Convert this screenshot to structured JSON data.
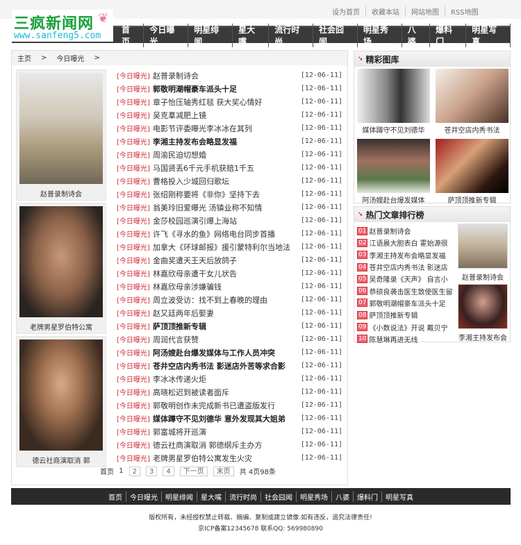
{
  "top_links": [
    "设为首页",
    "收藏本站",
    "网站地图",
    "RSS地图"
  ],
  "logo": {
    "name": "三疯新闻网",
    "url": "www.sanfeng5.com"
  },
  "nav": [
    "首页",
    "今日曝光",
    "明星绯闻",
    "星大嘴",
    "流行时尚",
    "社会囧闻",
    "明星秀场",
    "八婆",
    "爆料门",
    "明星写真"
  ],
  "breadcrumb": [
    "主页",
    ">",
    "今日曝光",
    ">"
  ],
  "left_pics": [
    {
      "caption": "赵普录制诗会"
    },
    {
      "caption": "老牌男星罗伯特公寓"
    },
    {
      "caption": "德云社商演取消 郭"
    }
  ],
  "list": [
    {
      "tag": "[今日曝光]",
      "title": "赵普录制诗会",
      "date": "[12-06-11]",
      "bold": false
    },
    {
      "tag": "[今日曝光]",
      "title": "郭敬明潮帽豪车派头十足",
      "date": "[12-06-11]",
      "bold": true
    },
    {
      "tag": "[今日曝光]",
      "title": "章子怡压轴秀红毯 获大奖心情好",
      "date": "[12-06-11]",
      "bold": false
    },
    {
      "tag": "[今日曝光]",
      "title": "吴克羣减肥上镜",
      "date": "[12-06-11]",
      "bold": false
    },
    {
      "tag": "[今日曝光]",
      "title": "电影节评委曝光李冰冰在其列",
      "date": "[12-06-11]",
      "bold": false
    },
    {
      "tag": "[今日曝光]",
      "title": "李湘主持发布会略显发福",
      "date": "[12-06-11]",
      "bold": true
    },
    {
      "tag": "[今日曝光]",
      "title": "周渝民迫切想婚",
      "date": "[12-06-11]",
      "bold": false
    },
    {
      "tag": "[今日曝光]",
      "title": "马国贤丢6千元手机获赔1千五",
      "date": "[12-06-11]",
      "bold": false
    },
    {
      "tag": "[今日曝光]",
      "title": "曹格投入少城回归歌坛",
      "date": "[12-06-11]",
      "bold": false
    },
    {
      "tag": "[今日曝光]",
      "title": "张绍刚称要将《非你》坚持下去",
      "date": "[12-06-11]",
      "bold": false
    },
    {
      "tag": "[今日曝光]",
      "title": "翁美玲旧爱曝光 汤镇业称不知情",
      "date": "[12-06-11]",
      "bold": false
    },
    {
      "tag": "[今日曝光]",
      "title": "金莎校园巡演引爆上海站",
      "date": "[12-06-11]",
      "bold": false
    },
    {
      "tag": "[今日曝光]",
      "title": "许飞《寻水的鱼》网络电台同步首播",
      "date": "[12-06-11]",
      "bold": false
    },
    {
      "tag": "[今日曝光]",
      "title": "加拿大《环球邮报》援引蒙特利尔当地法",
      "date": "[12-06-11]",
      "bold": false
    },
    {
      "tag": "[今日曝光]",
      "title": "金曲奖遭天王天后放鸽子",
      "date": "[12-06-11]",
      "bold": false
    },
    {
      "tag": "[今日曝光]",
      "title": "林嘉欣母亲遭干女儿状告",
      "date": "[12-06-11]",
      "bold": false
    },
    {
      "tag": "[今日曝光]",
      "title": "林嘉欣母亲涉嫌骗钱",
      "date": "[12-06-11]",
      "bold": false
    },
    {
      "tag": "[今日曝光]",
      "title": "周立波受访：找不到上春晚的理由",
      "date": "[12-06-11]",
      "bold": false
    },
    {
      "tag": "[今日曝光]",
      "title": "赵又廷两年后娶妻",
      "date": "[12-06-11]",
      "bold": false
    },
    {
      "tag": "[今日曝光]",
      "title": "萨顶顶推新专辑",
      "date": "[12-06-11]",
      "bold": true
    },
    {
      "tag": "[今日曝光]",
      "title": "周润代言获赞",
      "date": "[12-06-11]",
      "bold": false
    },
    {
      "tag": "[今日曝光]",
      "title": "阿汤嫂赴台爆发媒体与工作人员冲突",
      "date": "[12-06-11]",
      "bold": true
    },
    {
      "tag": "[今日曝光]",
      "title": "苍井空店内秀书法 影迷店外苦等求合影",
      "date": "[12-06-11]",
      "bold": true
    },
    {
      "tag": "[今日曝光]",
      "title": "李冰冰传递火炬",
      "date": "[12-06-11]",
      "bold": false
    },
    {
      "tag": "[今日曝光]",
      "title": "高晓松迟到被读者面斥",
      "date": "[12-06-11]",
      "bold": false
    },
    {
      "tag": "[今日曝光]",
      "title": "郭敬明创作未完成新书已遭盗版发行",
      "date": "[12-06-11]",
      "bold": false
    },
    {
      "tag": "[今日曝光]",
      "title": "媒体蹲守不见刘德华 意外发现其大姐弟",
      "date": "[12-06-11]",
      "bold": true
    },
    {
      "tag": "[今日曝光]",
      "title": "郭富城将开巡演",
      "date": "[12-06-11]",
      "bold": false
    },
    {
      "tag": "[今日曝光]",
      "title": "德云社商演取消 郭德纲斥主办方",
      "date": "[12-06-11]",
      "bold": false
    },
    {
      "tag": "[今日曝光]",
      "title": "老牌男星罗伯特公寓发生火灾",
      "date": "[12-06-11]",
      "bold": false
    }
  ],
  "pager": {
    "first": "首页",
    "current": "1",
    "pages": [
      "2",
      "3",
      "4"
    ],
    "next": "下一页",
    "last": "末页",
    "summary": "共 4页98条"
  },
  "gallery": {
    "title": "精彩图库",
    "items": [
      {
        "caption": "媒体蹲守不见刘德华"
      },
      {
        "caption": "苍井空店内秀书法"
      },
      {
        "caption": "阿汤嫂赴台爆发媒体"
      },
      {
        "caption": "萨顶顶推新专辑"
      }
    ]
  },
  "hot": {
    "title": "热门文章排行榜",
    "items": [
      {
        "num": "01",
        "title": "赵普录制诗会"
      },
      {
        "num": "02",
        "title": "江语晨大胆表白 霍始源很"
      },
      {
        "num": "03",
        "title": "李湘主持发布会略显发福"
      },
      {
        "num": "04",
        "title": "苍井空店内秀书法 影迷店"
      },
      {
        "num": "05",
        "title": "吴奇隆录《天声》 自言小"
      },
      {
        "num": "06",
        "title": "恭硕良袭击医生致使医生留"
      },
      {
        "num": "07",
        "title": "郭敬明潮帽豪车派头十足"
      },
      {
        "num": "08",
        "title": "萨顶顶推新专辑"
      },
      {
        "num": "09",
        "title": "《小数说法》开说 戴贝宁"
      },
      {
        "num": "10",
        "title": "陈慧琳再进无线"
      }
    ],
    "pics": [
      {
        "caption": "赵普录制诗会"
      },
      {
        "caption": "李湘主持发布会"
      }
    ]
  },
  "footer": {
    "nav": [
      "首页",
      "今日曝光",
      "明星绯闻",
      "星大嘴",
      "流行时尚",
      "社会囧闻",
      "明星秀场",
      "八婆",
      "爆料门",
      "明星写真"
    ],
    "copyright": "版权所有，未经授权禁止转载、摘编、复制或建立镜像.如有违反，追究法律责任!",
    "icp": "京ICP备案12345678  联系QQ: 569980890"
  }
}
